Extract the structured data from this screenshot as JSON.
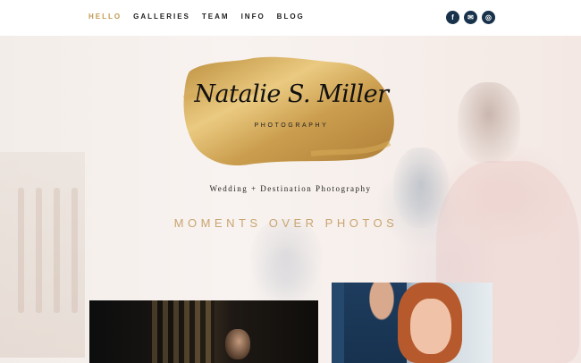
{
  "nav": {
    "items": [
      {
        "label": "HELLO",
        "active": true
      },
      {
        "label": "GALLERIES",
        "active": false
      },
      {
        "label": "TEAM",
        "active": false
      },
      {
        "label": "INFO",
        "active": false
      },
      {
        "label": "BLOG",
        "active": false
      }
    ]
  },
  "social": [
    {
      "icon": "facebook-icon",
      "glyph": "f"
    },
    {
      "icon": "email-icon",
      "glyph": "✉"
    },
    {
      "icon": "instagram-icon",
      "glyph": "◎"
    }
  ],
  "logo": {
    "signature": "Natalie S. Miller",
    "subtitle": "PHOTOGRAPHY"
  },
  "hero": {
    "tagline": "Wedding + Destination Photography",
    "motto": "MOMENTS OVER PHOTOS"
  },
  "colors": {
    "accent_gold": "#c19a52",
    "motto_gold": "#c9a571",
    "social_navy": "#17324a"
  }
}
